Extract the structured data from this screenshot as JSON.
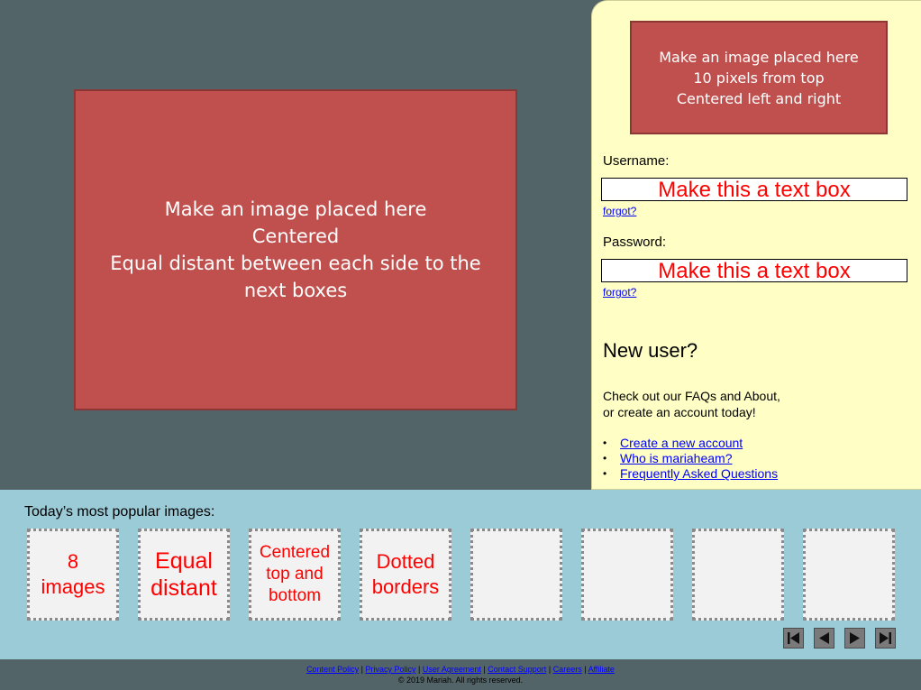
{
  "hero": {
    "lines": [
      "Make an image placed here",
      "Centered",
      "Equal distant between each side to the next boxes"
    ]
  },
  "sidebar": {
    "image_lines": [
      "Make an image placed here",
      "10 pixels from top",
      "Centered left and right"
    ],
    "username_label": "Username:",
    "username_box": "Make this a text box",
    "forgot1": "forgot?",
    "password_label": "Password:",
    "password_box": "Make this a text box",
    "forgot2": "forgot?",
    "new_user": "New user?",
    "desc_line1": "Check out our FAQs and About,",
    "desc_line2": "or create an account today!",
    "links": [
      "Create a new account",
      "Who is mariaheam?",
      "Frequently Asked Questions"
    ],
    "bullet": "•"
  },
  "popular": {
    "title": "Today’s most popular images:",
    "thumbs": [
      {
        "l1": "8",
        "l2": "images",
        "l3": ""
      },
      {
        "l1": "Equal",
        "l2": "distant",
        "l3": ""
      },
      {
        "l1": "Centered",
        "l2": "top and",
        "l3": "bottom"
      },
      {
        "l1": "Dotted",
        "l2": "borders",
        "l3": ""
      },
      {
        "l1": "",
        "l2": "",
        "l3": ""
      },
      {
        "l1": "",
        "l2": "",
        "l3": ""
      },
      {
        "l1": "",
        "l2": "",
        "l3": ""
      },
      {
        "l1": "",
        "l2": "",
        "l3": ""
      }
    ],
    "nav_icons": [
      "first-page-icon",
      "previous-icon",
      "next-icon",
      "last-page-icon"
    ]
  },
  "footer": {
    "links": [
      "Content Policy",
      "Privacy Policy",
      "User Agreement",
      "Contact Support",
      "Careers",
      "Affiliate"
    ],
    "separator": "|",
    "copyright": "© 2019 Mariah.  All rights reserved."
  },
  "colors": {
    "background": "#536468",
    "panel": "#ffffc5",
    "red_box": "#c0504d",
    "band": "#9ccbd8",
    "link": "#0000ff",
    "placeholder_text": "#ff0000"
  }
}
